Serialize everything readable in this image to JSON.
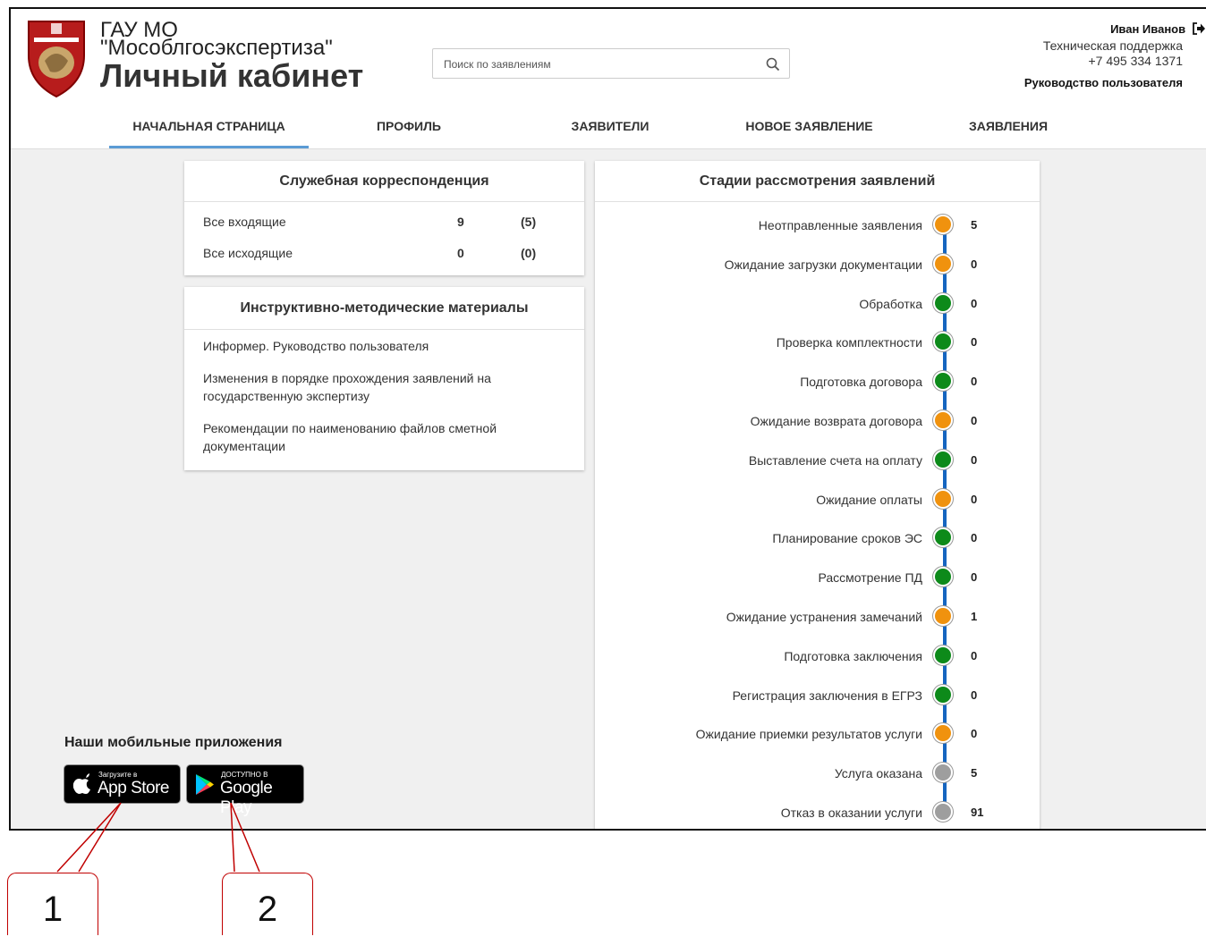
{
  "header": {
    "org_line1": "ГАУ МО",
    "org_line2": "\"Мособлгосэкспертиза\"",
    "cabinet_title": "Личный кабинет",
    "search_placeholder": "Поиск по заявлениям",
    "user_name": "Иван Иванов",
    "support_label": "Техническая поддержка",
    "support_phone": "+7 495 334 1371",
    "guide_link": "Руководство пользователя"
  },
  "nav": {
    "tabs": [
      {
        "label": "НАЧАЛЬНАЯ СТРАНИЦА",
        "active": true
      },
      {
        "label": "ПРОФИЛЬ",
        "active": false
      },
      {
        "label": "ЗАЯВИТЕЛИ",
        "active": false
      },
      {
        "label": "НОВОЕ ЗАЯВЛЕНИЕ",
        "active": false
      },
      {
        "label": "ЗАЯВЛЕНИЯ",
        "active": false
      }
    ]
  },
  "correspondence": {
    "title": "Служебная корреспонденция",
    "rows": [
      {
        "label": "Все входящие",
        "count": "9",
        "new": "(5)"
      },
      {
        "label": "Все исходящие",
        "count": "0",
        "new": "(0)"
      }
    ]
  },
  "materials": {
    "title": "Инструктивно-методические материалы",
    "items": [
      "Информер. Руководство пользователя",
      "Изменения в порядке прохождения заявлений на государственную экспертизу",
      "Рекомендации по наименованию файлов сметной документации"
    ]
  },
  "stages": {
    "title": "Стадии рассмотрения заявлений",
    "items": [
      {
        "label": "Неотправленные заявления",
        "count": "5",
        "status": "orange"
      },
      {
        "label": "Ожидание загрузки документации",
        "count": "0",
        "status": "orange"
      },
      {
        "label": "Обработка",
        "count": "0",
        "status": "green"
      },
      {
        "label": "Проверка комплектности",
        "count": "0",
        "status": "green"
      },
      {
        "label": "Подготовка договора",
        "count": "0",
        "status": "green"
      },
      {
        "label": "Ожидание возврата договора",
        "count": "0",
        "status": "orange"
      },
      {
        "label": "Выставление счета на оплату",
        "count": "0",
        "status": "green"
      },
      {
        "label": "Ожидание оплаты",
        "count": "0",
        "status": "orange"
      },
      {
        "label": "Планирование сроков ЭС",
        "count": "0",
        "status": "green"
      },
      {
        "label": "Рассмотрение ПД",
        "count": "0",
        "status": "green"
      },
      {
        "label": "Ожидание устранения замечаний",
        "count": "1",
        "status": "orange"
      },
      {
        "label": "Подготовка заключения",
        "count": "0",
        "status": "green"
      },
      {
        "label": "Регистрация заключения в ЕГРЗ",
        "count": "0",
        "status": "green"
      },
      {
        "label": "Ожидание приемки результатов услуги",
        "count": "0",
        "status": "orange"
      },
      {
        "label": "Услуга оказана",
        "count": "5",
        "status": "gray"
      },
      {
        "label": "Отказ в оказании услуги",
        "count": "91",
        "status": "gray"
      }
    ]
  },
  "status_colors": {
    "orange": "#f0920e",
    "green": "#0d8a1a",
    "gray": "#9e9e9e",
    "line": "#1565c0"
  },
  "apps": {
    "title": "Наши мобильные приложения",
    "appstore_small": "Загрузите в",
    "appstore_big": "App Store",
    "googleplay_small": "ДОСТУПНО В",
    "googleplay_big": "Google Play"
  },
  "callouts": [
    "1",
    "2"
  ]
}
